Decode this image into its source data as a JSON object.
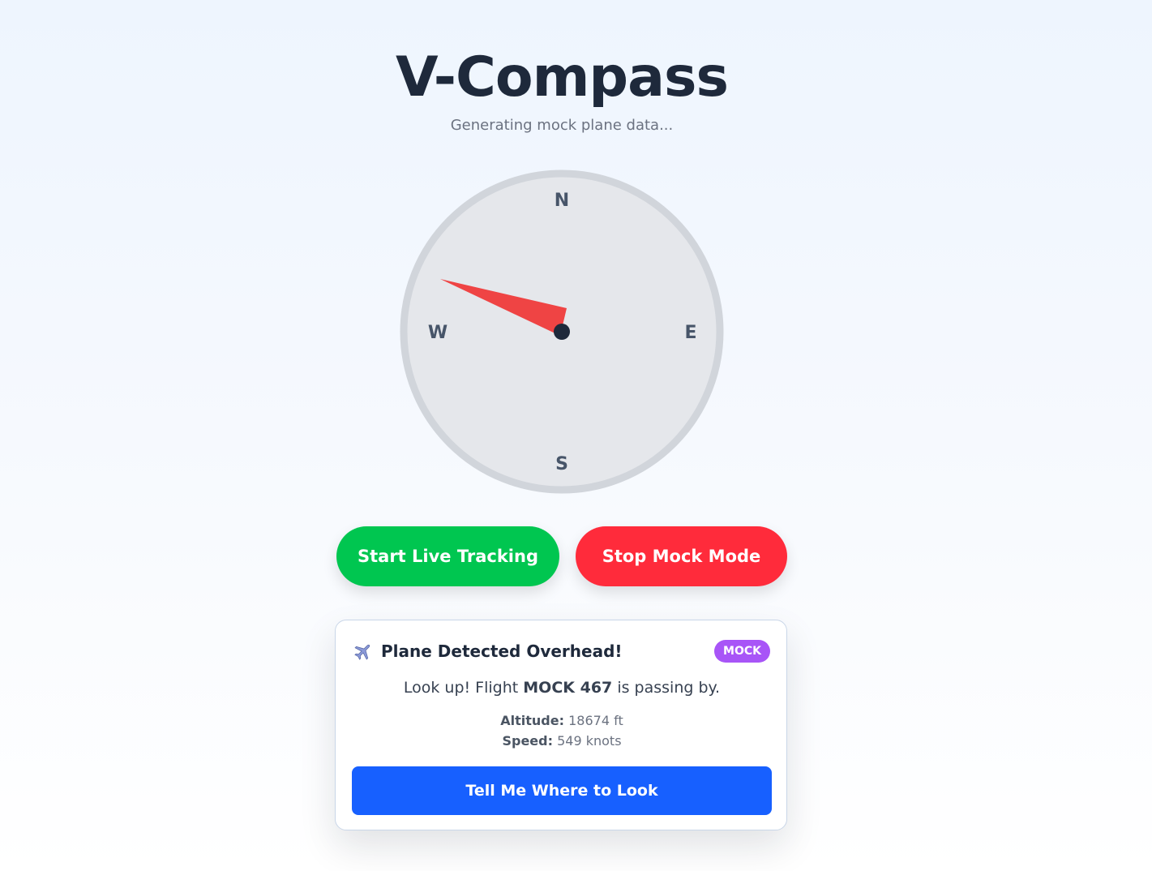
{
  "header": {
    "title": "V-Compass",
    "subtitle": "Generating mock plane data..."
  },
  "compass": {
    "north": "N",
    "east": "E",
    "south": "S",
    "west": "W",
    "needle_color": "#ef4444"
  },
  "controls": {
    "live_label": "Start Live Tracking",
    "stop_label": "Stop Mock Mode",
    "live_color": "#00c650",
    "stop_color": "#ff2b3b"
  },
  "card": {
    "icon": "airplane-icon",
    "title": "Plane Detected Overhead!",
    "badge": "MOCK",
    "msg_prefix": "Look up! Flight ",
    "flight": "MOCK 467",
    "msg_suffix": " is passing by.",
    "altitude_label": "Altitude:",
    "altitude_value": "18674 ft",
    "speed_label": "Speed:",
    "speed_value": "549 knots",
    "look_label": "Tell Me Where to Look",
    "accent": "#1760ff"
  }
}
